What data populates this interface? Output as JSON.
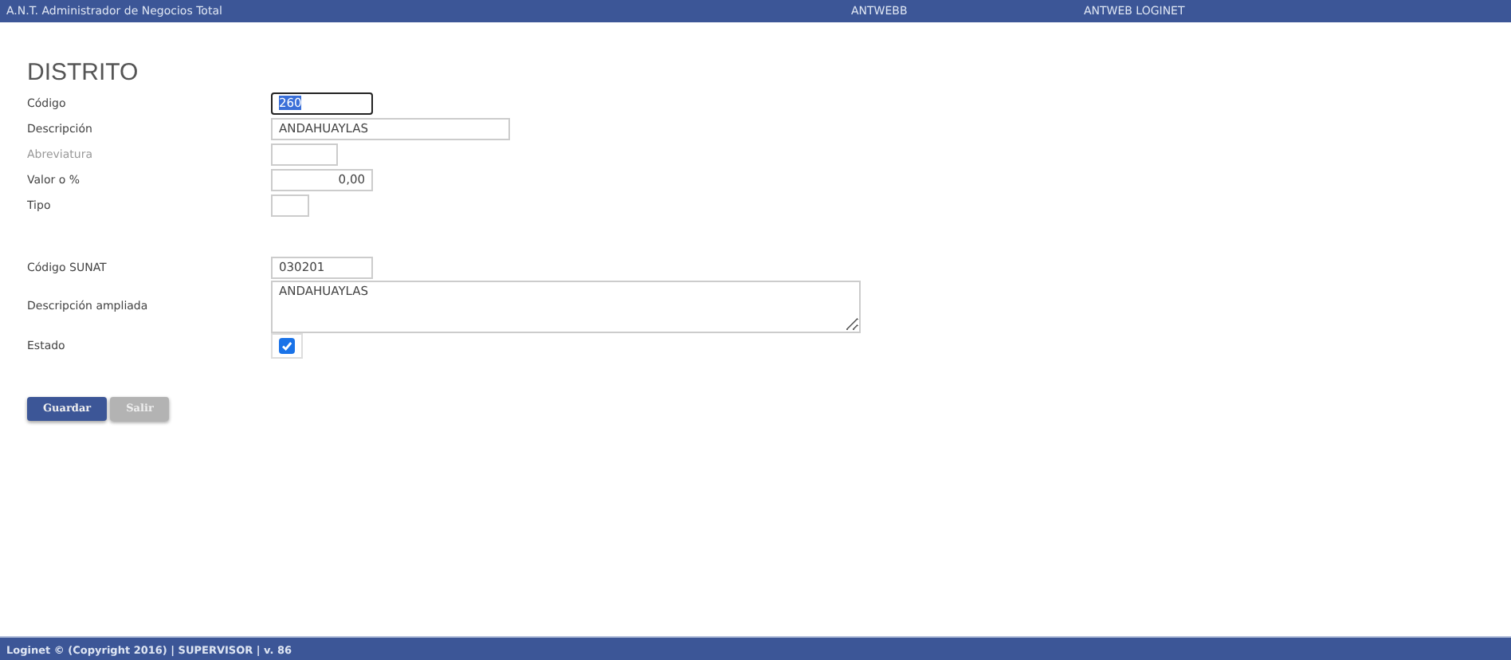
{
  "header": {
    "app_title": "A.N.T. Administrador de Negocios Total",
    "links": [
      "ANTWEBB",
      "ANTWEB LOGINET"
    ]
  },
  "form": {
    "title": "DISTRITO",
    "sections": [
      [
        {
          "label": "Código",
          "kind": "text",
          "value": "260",
          "text_selected": true,
          "disabled": false
        },
        {
          "label": "Descripción",
          "kind": "text",
          "value": "ANDAHUAYLAS",
          "disabled": false
        },
        {
          "label": "Abreviatura",
          "kind": "text",
          "disabled": true
        },
        {
          "label": "Valor o %",
          "kind": "number",
          "value": "0,00",
          "disabled": false
        },
        {
          "label": "Tipo",
          "kind": "text",
          "disabled": false
        }
      ],
      [
        {
          "label": "Código SUNAT",
          "kind": "text",
          "value": "030201",
          "disabled": false
        },
        {
          "label": "Descripción ampliada",
          "kind": "textarea",
          "value": "ANDAHUAYLAS",
          "disabled": false
        },
        {
          "label": "Estado",
          "kind": "checkbox",
          "checked": true,
          "disabled": false
        }
      ]
    ],
    "buttons": [
      {
        "label": "Guardar",
        "kind": "primary"
      },
      {
        "label": "Salir",
        "kind": "secondary"
      }
    ]
  },
  "footer": {
    "text": "Loginet © (Copyright 2016) | SUPERVISOR | v. 86"
  }
}
